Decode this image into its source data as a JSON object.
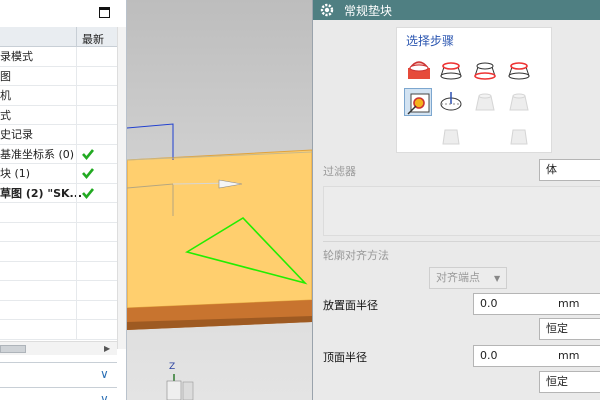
{
  "navigator": {
    "column_latest": "最新",
    "rows": [
      {
        "label": "录模式",
        "bold": false,
        "check": false
      },
      {
        "label": "图",
        "bold": false,
        "check": false
      },
      {
        "label": "机",
        "bold": false,
        "check": false
      },
      {
        "label": "式",
        "bold": false,
        "check": false
      },
      {
        "label": "史记录",
        "bold": false,
        "check": false
      },
      {
        "label": "基准坐标系 (0)",
        "bold": false,
        "check": true
      },
      {
        "label": "块 (1)",
        "bold": false,
        "check": true
      },
      {
        "label": "草图 (2) \"SK...",
        "bold": true,
        "check": true
      },
      {
        "label": "",
        "bold": false,
        "check": false
      },
      {
        "label": "",
        "bold": false,
        "check": false
      },
      {
        "label": "",
        "bold": false,
        "check": false
      },
      {
        "label": "",
        "bold": false,
        "check": false
      },
      {
        "label": "",
        "bold": false,
        "check": false
      },
      {
        "label": "",
        "bold": false,
        "check": false
      },
      {
        "label": "",
        "bold": false,
        "check": false
      }
    ]
  },
  "dialog": {
    "title": "常规垫块",
    "steps_label": "选择步骤",
    "filter_label": "过滤器",
    "filter_value": "体",
    "profile_align_label": "轮廓对齐方法",
    "align_value": "对齐端点",
    "place_radius_label": "放置面半径",
    "place_radius_value": "0.0",
    "place_radius_unit": "mm",
    "place_radius_mode": "恒定",
    "top_radius_label": "顶面半径",
    "top_radius_value": "0.0",
    "top_radius_unit": "mm",
    "top_radius_mode": "恒定"
  },
  "viewport": {
    "axis_label_z": "Z"
  },
  "colors": {
    "title_bar": "#4f7f82",
    "check_green": "#22aa22",
    "block_top": "#ffcf6e",
    "block_side": "#c8742f",
    "sketch_line": "#22ee00",
    "steps_label": "#2a55b0"
  }
}
